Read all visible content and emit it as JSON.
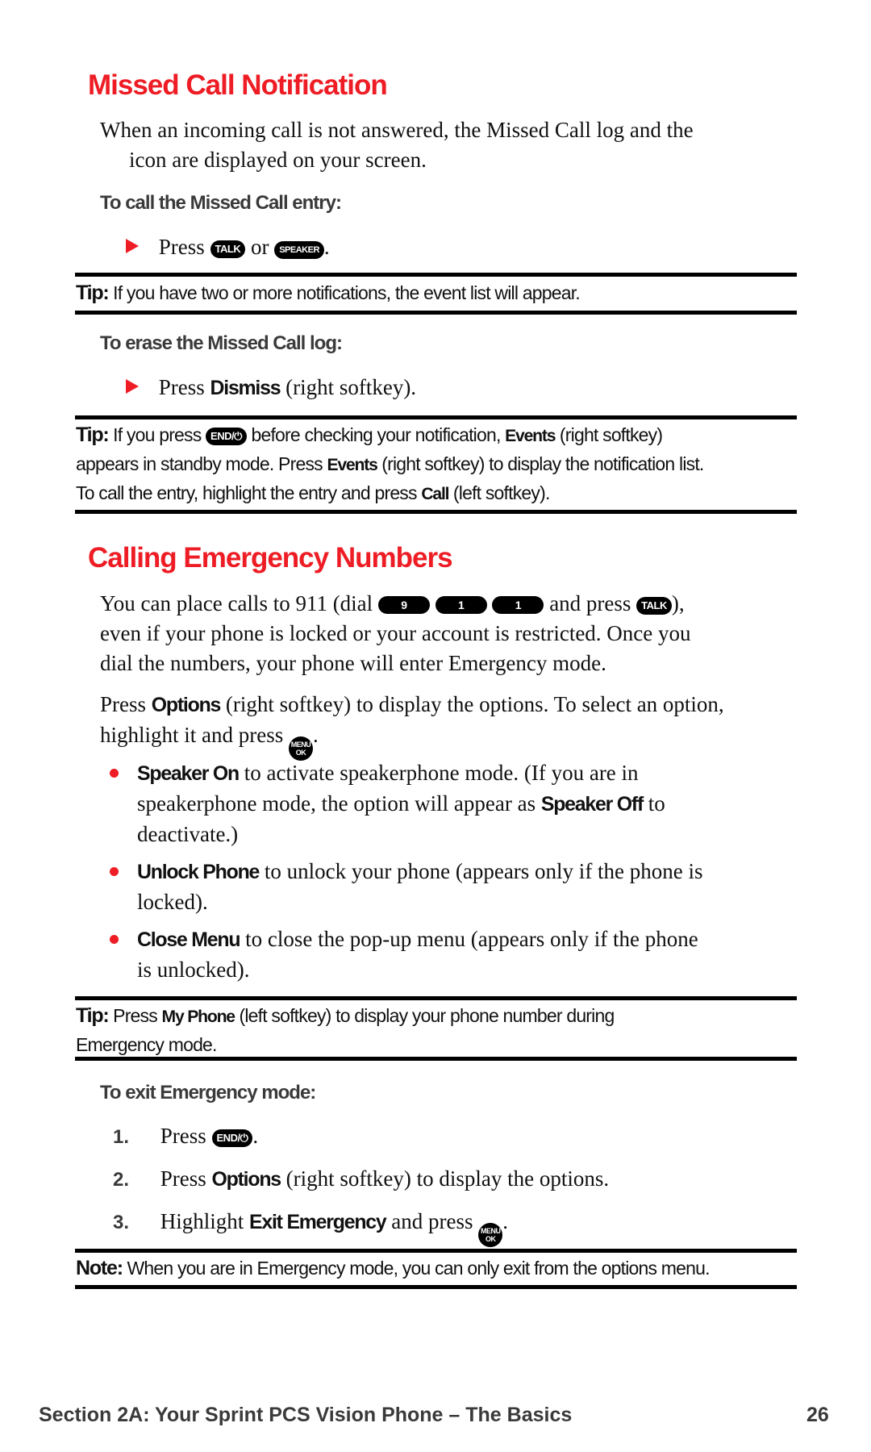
{
  "section1": {
    "title": "Missed Call Notification",
    "intro": "When an incoming call is not answered, the Missed Call log and the icon are displayed on your screen.",
    "intro_line1": "When an incoming call is not answered, the Missed Call log and the",
    "intro_line2": "icon are displayed on your screen.",
    "call_heading": "To call the Missed Call entry:",
    "call_step": {
      "prefix": "Press",
      "key1": "TALK",
      "mid": "or",
      "key2": "SPEAKER",
      "suffix": "."
    },
    "tip1": {
      "label": "Tip:",
      "text": "If you have two or more notifications, the event list will appear."
    },
    "erase_heading": "To erase the Missed Call log:",
    "erase_step": {
      "prefix": "Press",
      "bold": "Dismiss",
      "suffix": "(right softkey)."
    },
    "tip2": {
      "label": "Tip:",
      "t1": "If you press",
      "key": "END/⏻",
      "t2": "before checking your notification,",
      "b1": "Events",
      "t3": "(right softkey)",
      "t4": "appears in standby mode. Press",
      "b2": "Events",
      "t5": "(right softkey) to display the notification list.",
      "t6": "To call the entry, highlight the entry and press",
      "b3": "Call",
      "t7": "(left softkey)."
    }
  },
  "section2": {
    "title": "Calling Emergency Numbers",
    "p1": {
      "t1": "You can place calls to 911 (dial",
      "keys": [
        "9",
        "1",
        "1"
      ],
      "t2": "and press",
      "key_talk": "TALK",
      "t3": "),",
      "line2": "even if your phone is locked or your account is restricted. Once you",
      "line3": "dial the numbers, your phone will enter Emergency mode."
    },
    "p2": {
      "t1": "Press",
      "b1": "Options",
      "t2": "(right softkey) to display the options. To select an option,",
      "t3": "highlight it and press",
      "key_top": "MENU",
      "key_bottom": "OK",
      "t4": "."
    },
    "bullets": [
      {
        "bold": "Speaker On",
        "line1": "to activate speakerphone mode. (If you are in",
        "line2a": "speakerphone mode, the option will appear as",
        "bold2": "Speaker Off",
        "line2b": "to",
        "line3": "deactivate.)"
      },
      {
        "bold": "Unlock Phone",
        "line1": "to unlock your phone (appears only if the phone is",
        "line2": "locked)."
      },
      {
        "bold": "Close Menu",
        "line1": "to close the pop-up menu (appears only if the phone",
        "line2": "is unlocked)."
      }
    ],
    "tip3": {
      "label": "Tip:",
      "t1": "Press",
      "b1": "My Phone",
      "t2": "(left softkey) to display your phone number during",
      "t3": "Emergency mode."
    },
    "exit_heading": "To exit Emergency mode:",
    "steps": [
      {
        "num": "1.",
        "t1": "Press",
        "key": "END/⏻",
        "t2": "."
      },
      {
        "num": "2.",
        "t1": "Press",
        "bold": "Options",
        "t2": "(right softkey) to display the options."
      },
      {
        "num": "3.",
        "t1": "Highlight",
        "bold": "Exit Emergency",
        "t2": "and press",
        "key_top": "MENU",
        "key_bottom": "OK",
        "t3": "."
      }
    ],
    "note": {
      "label": "Note:",
      "text": "When you are in Emergency mode, you can only exit from the options menu."
    }
  },
  "footer": {
    "section": "Section 2A: Your Sprint PCS Vision Phone – The Basics",
    "page": "26"
  },
  "colors": {
    "accent": "#ee1c24",
    "text": "#111111",
    "subheading": "#3a3a3a"
  }
}
